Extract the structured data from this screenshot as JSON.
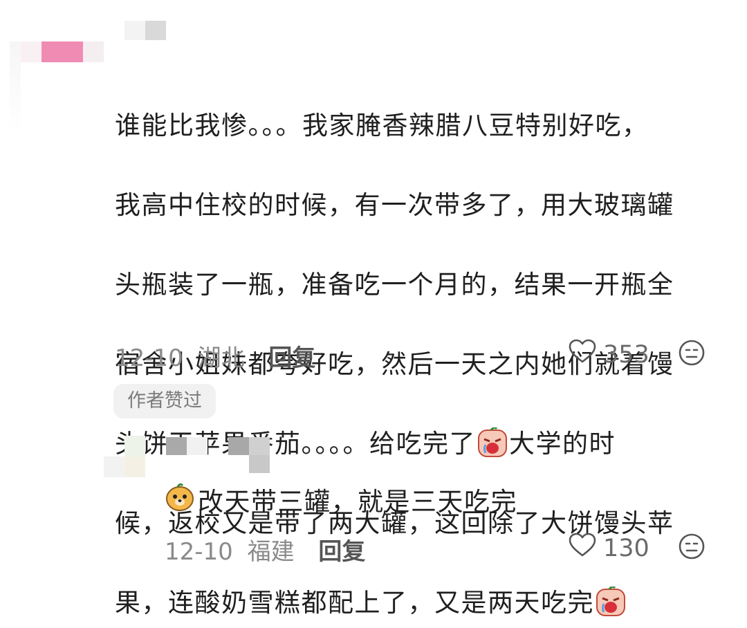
{
  "comment": {
    "lines": [
      "谁能比我惨。。。我家腌香辣腊八豆特别好吃，",
      "我高中住校的时候，有一次带多了，用大玻璃罐",
      "头瓶装了一瓶，准备吃一个月的，结果一开瓶全",
      "宿舍小姐妹都夸好吃，然后一天之内她们就着馒",
      "头饼干苹果番茄。。。。给吃完了",
      "大学的时",
      "候，返校又是带了两大罐，这回除了大饼馒头苹",
      "果，连酸奶雪糕都配上了，又是两天吃完"
    ],
    "date": "12-10",
    "location": "湖北",
    "reply_label": "回复",
    "likes": "353",
    "badge": "作者赞过"
  },
  "reply": {
    "text": "改天带三罐，就是三天吃完",
    "date": "12-10",
    "location": "福建",
    "reply_label": "回复",
    "likes": "130"
  },
  "icons": {
    "like": "heart-outline-icon",
    "dislike": "neutral-face-icon",
    "emoji_cry": "crying-face-emoji",
    "emoji_doge": "dog-face-emoji"
  },
  "colors": {
    "text": "#1f1f1f",
    "meta": "#8a8a8a",
    "badge_bg": "#f1f1f1",
    "avatar_pink": "#f0a0c0"
  }
}
